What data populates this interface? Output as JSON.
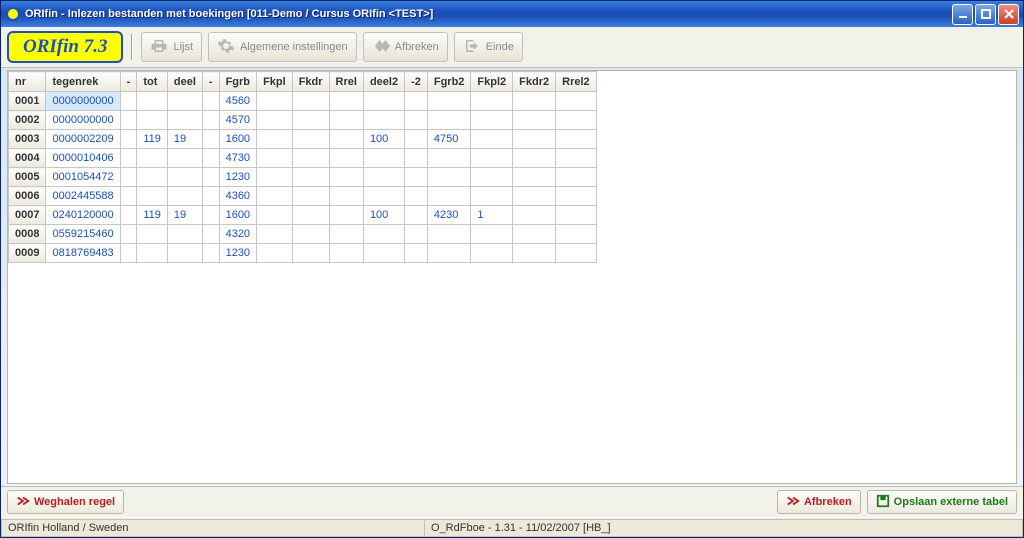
{
  "titlebar": {
    "title": "ORIfin - Inlezen bestanden met boekingen [011-Demo / Cursus ORIfin <TEST>]"
  },
  "brand": {
    "label": "ORIfin 7.3"
  },
  "toolbar": {
    "lijst": "Lijst",
    "algemene": "Algemene instellingen",
    "afbreken": "Afbreken",
    "einde": "Einde"
  },
  "grid": {
    "headers": [
      "nr",
      "tegenrek",
      "-",
      "tot",
      "deel",
      "-",
      "Fgrb",
      "Fkpl",
      "Fkdr",
      "Rrel",
      "deel2",
      "-2",
      "Fgrb2",
      "Fkpl2",
      "Fkdr2",
      "Rrel2"
    ],
    "rows": [
      {
        "nr": "0001",
        "tegenrek": "0000000000",
        "c3": "",
        "tot": "",
        "deel": "",
        "c6": "",
        "Fgrb": "4560",
        "Fkpl": "",
        "Fkdr": "",
        "Rrel": "",
        "deel2": "",
        "c12": "",
        "Fgrb2": "",
        "Fkpl2": "",
        "Fkdr2": "",
        "Rrel2": "",
        "selected": true
      },
      {
        "nr": "0002",
        "tegenrek": "0000000000",
        "c3": "",
        "tot": "",
        "deel": "",
        "c6": "",
        "Fgrb": "4570",
        "Fkpl": "",
        "Fkdr": "",
        "Rrel": "",
        "deel2": "",
        "c12": "",
        "Fgrb2": "",
        "Fkpl2": "",
        "Fkdr2": "",
        "Rrel2": ""
      },
      {
        "nr": "0003",
        "tegenrek": "0000002209",
        "c3": "",
        "tot": "119",
        "deel": "19",
        "c6": "",
        "Fgrb": "1600",
        "Fkpl": "",
        "Fkdr": "",
        "Rrel": "",
        "deel2": "100",
        "c12": "",
        "Fgrb2": "4750",
        "Fkpl2": "",
        "Fkdr2": "",
        "Rrel2": ""
      },
      {
        "nr": "0004",
        "tegenrek": "0000010406",
        "c3": "",
        "tot": "",
        "deel": "",
        "c6": "",
        "Fgrb": "4730",
        "Fkpl": "",
        "Fkdr": "",
        "Rrel": "",
        "deel2": "",
        "c12": "",
        "Fgrb2": "",
        "Fkpl2": "",
        "Fkdr2": "",
        "Rrel2": ""
      },
      {
        "nr": "0005",
        "tegenrek": "0001054472",
        "c3": "",
        "tot": "",
        "deel": "",
        "c6": "",
        "Fgrb": "1230",
        "Fkpl": "",
        "Fkdr": "",
        "Rrel": "",
        "deel2": "",
        "c12": "",
        "Fgrb2": "",
        "Fkpl2": "",
        "Fkdr2": "",
        "Rrel2": ""
      },
      {
        "nr": "0006",
        "tegenrek": "0002445588",
        "c3": "",
        "tot": "",
        "deel": "",
        "c6": "",
        "Fgrb": "4360",
        "Fkpl": "",
        "Fkdr": "",
        "Rrel": "",
        "deel2": "",
        "c12": "",
        "Fgrb2": "",
        "Fkpl2": "",
        "Fkdr2": "",
        "Rrel2": ""
      },
      {
        "nr": "0007",
        "tegenrek": "0240120000",
        "c3": "",
        "tot": "119",
        "deel": "19",
        "c6": "",
        "Fgrb": "1600",
        "Fkpl": "",
        "Fkdr": "",
        "Rrel": "",
        "deel2": "100",
        "c12": "",
        "Fgrb2": "4230",
        "Fkpl2": "1",
        "Fkdr2": "",
        "Rrel2": ""
      },
      {
        "nr": "0008",
        "tegenrek": "0559215460",
        "c3": "",
        "tot": "",
        "deel": "",
        "c6": "",
        "Fgrb": "4320",
        "Fkpl": "",
        "Fkdr": "",
        "Rrel": "",
        "deel2": "",
        "c12": "",
        "Fgrb2": "",
        "Fkpl2": "",
        "Fkdr2": "",
        "Rrel2": ""
      },
      {
        "nr": "0009",
        "tegenrek": "0818769483",
        "c3": "",
        "tot": "",
        "deel": "",
        "c6": "",
        "Fgrb": "1230",
        "Fkpl": "",
        "Fkdr": "",
        "Rrel": "",
        "deel2": "",
        "c12": "",
        "Fgrb2": "",
        "Fkpl2": "",
        "Fkdr2": "",
        "Rrel2": ""
      }
    ]
  },
  "actions": {
    "weghalen": "Weghalen regel",
    "afbreken": "Afbreken",
    "opslaan": "Opslaan externe tabel"
  },
  "status": {
    "left": "ORIfin Holland / Sweden",
    "right": "O_RdFboe - 1.31 - 11/02/2007 [HB_]"
  }
}
